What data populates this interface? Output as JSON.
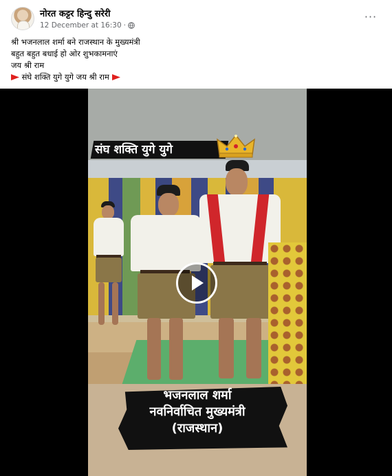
{
  "post": {
    "author": "नोरत कट्टर हिन्दु सरेरी",
    "timestamp": "12 December at 16:30",
    "separator": "·",
    "privacy_icon": "globe-icon",
    "more_icon": "more-options-icon",
    "more_label": "···"
  },
  "caption": {
    "lines": [
      "श्री भजनलाल शर्मा बने राजस्थान के मुख्यमंत्री",
      "बहुत बहुत बधाई हो ओर शुभकामनाएं",
      "जय श्री राम",
      "संघे शक्ति युगे युगे जय श्री राम"
    ],
    "flag_icon": "red-flag-icon"
  },
  "video": {
    "overlay_top": "संघ शक्ति युगे युगे",
    "overlay_bottom": [
      "भजनलाल शर्मा",
      "नवनिर्वाचित मुख्यमंत्री",
      "(राजस्थान)"
    ],
    "play_icon": "play-icon",
    "crown_icon": "crown-icon"
  }
}
